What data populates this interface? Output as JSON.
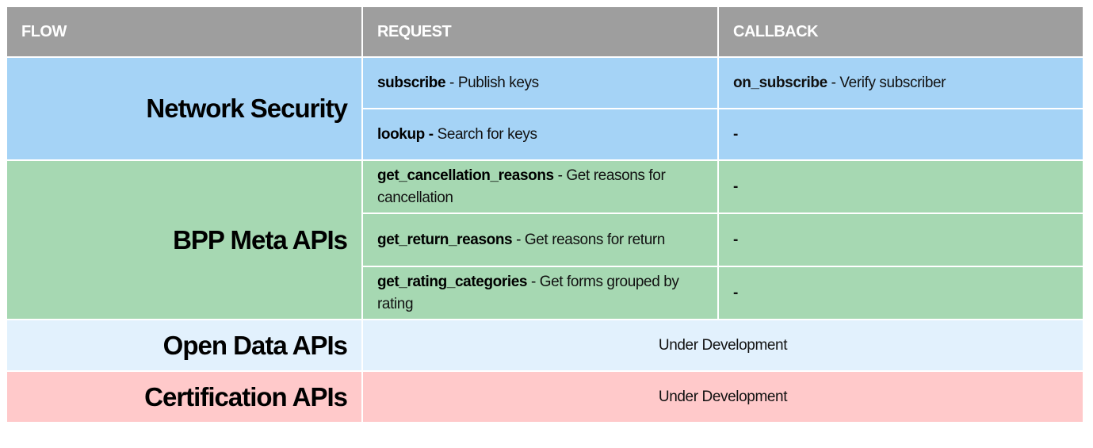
{
  "header": {
    "flow": "FLOW",
    "request": "REQUEST",
    "callback": "CALLBACK"
  },
  "colors": {
    "header": "#9e9e9e",
    "network_security": "#a5d3f6",
    "bpp_meta": "#a6d8b2",
    "open_data": "#e2f1fd",
    "certification": "#ffc9ca"
  },
  "groups": {
    "network_security": {
      "flow": "Network Security",
      "rows": [
        {
          "req_name": "subscribe",
          "req_desc": " - Publish keys",
          "cb_name": "on_subscribe",
          "cb_desc": " - Verify subscriber"
        },
        {
          "req_name": "lookup -",
          "req_desc": " Search for keys",
          "cb": "-"
        }
      ]
    },
    "bpp_meta": {
      "flow": "BPP Meta APIs",
      "rows": [
        {
          "req_name": "get_cancellation_reasons",
          "req_desc": " - Get reasons for cancellation",
          "cb": "-"
        },
        {
          "req_name": "get_return_reasons",
          "req_desc": " - Get reasons for return",
          "cb": "-"
        },
        {
          "req_name": "get_rating_categories",
          "req_desc": " - Get forms grouped by rating",
          "cb": "-"
        }
      ]
    },
    "open_data": {
      "flow": "Open Data APIs",
      "status": "Under Development"
    },
    "certification": {
      "flow": "Certification APIs",
      "status": "Under Development"
    }
  }
}
